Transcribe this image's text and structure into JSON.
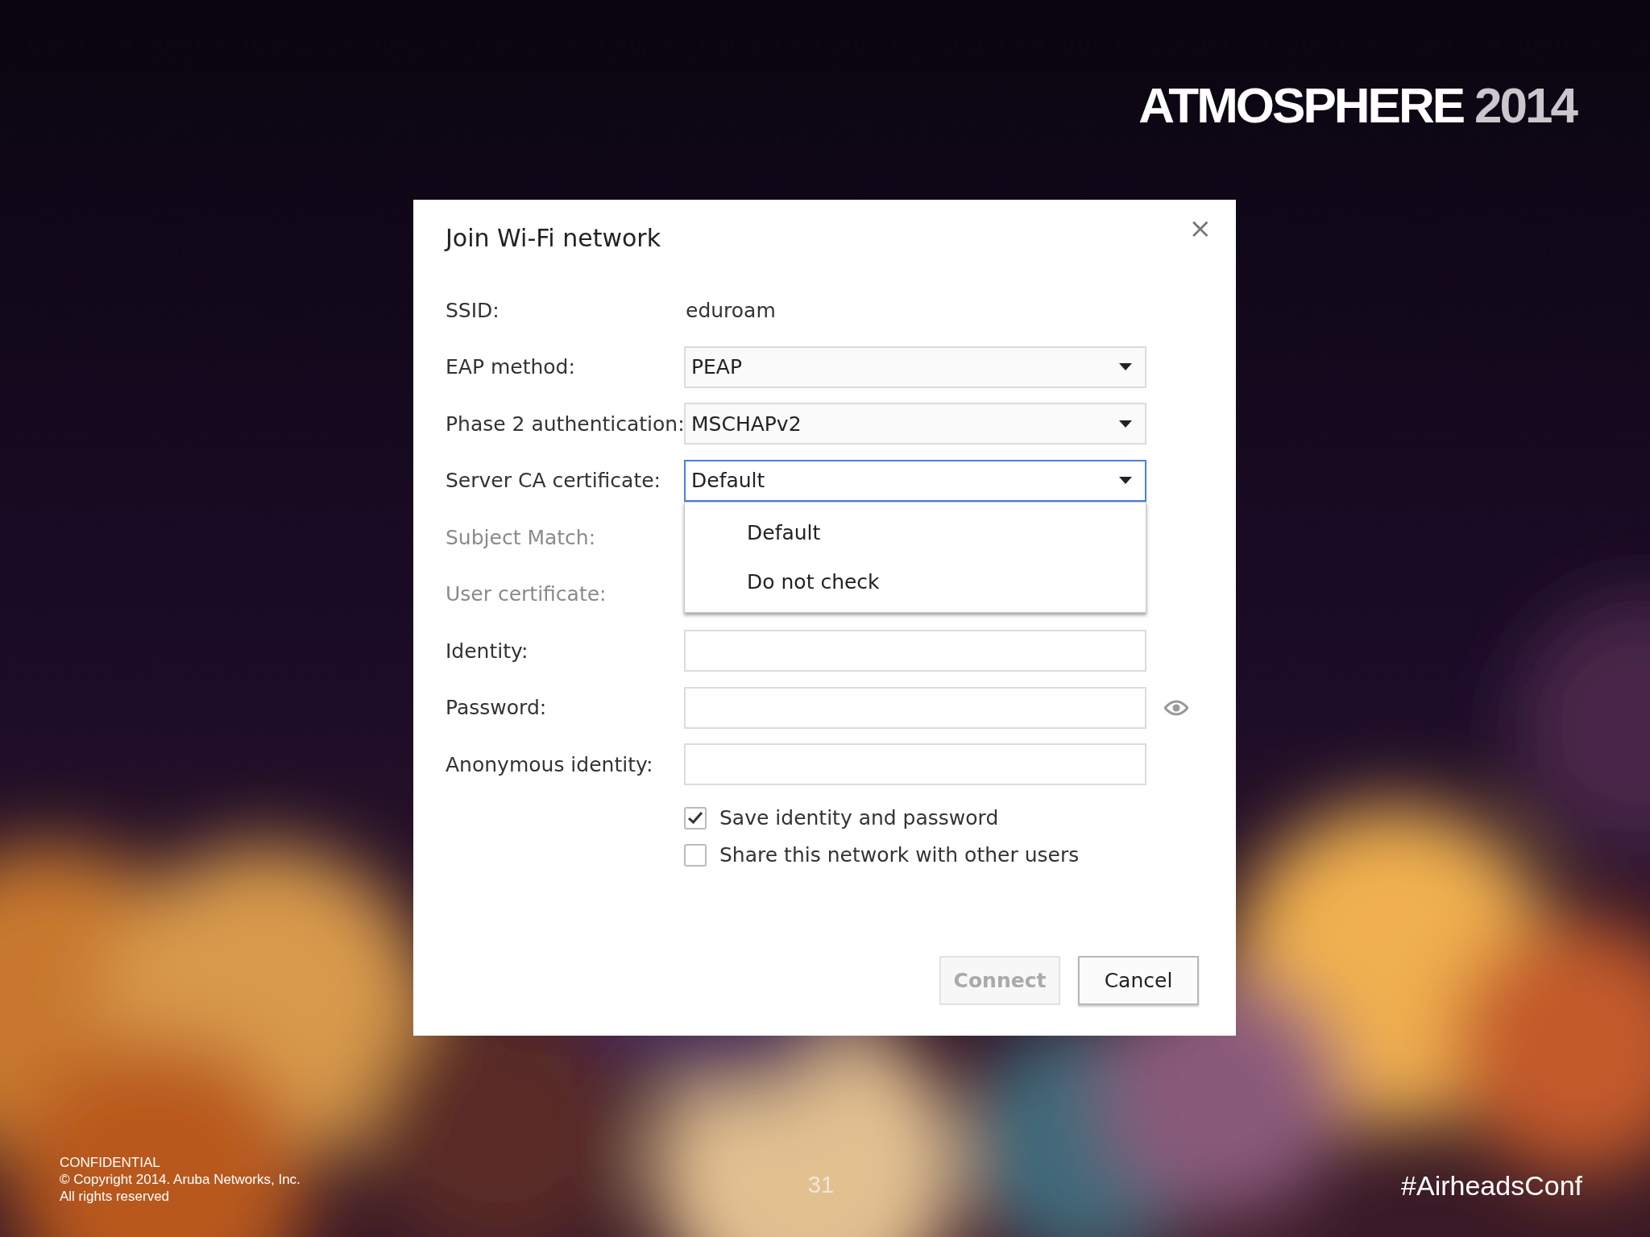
{
  "header": {
    "brand": "ATMOSPHERE",
    "year": "2014"
  },
  "dialog": {
    "title": "Join Wi-Fi network",
    "close": "×",
    "rows": [
      {
        "kind": "text",
        "label": "SSID:",
        "value": "eduroam",
        "disabled": false
      },
      {
        "kind": "select",
        "label": "EAP method:",
        "value": "PEAP",
        "disabled": false
      },
      {
        "kind": "select",
        "label": "Phase 2 authentication:",
        "value": "MSCHAPv2",
        "disabled": false
      },
      {
        "kind": "select",
        "label": "Server CA certificate:",
        "value": "Default",
        "disabled": false,
        "focused": true,
        "expanded": true,
        "options": [
          "Default",
          "Do not check"
        ]
      },
      {
        "kind": "blank",
        "label": "Subject Match:",
        "disabled": true
      },
      {
        "kind": "blank",
        "label": "User certificate:",
        "disabled": true
      },
      {
        "kind": "input",
        "label": "Identity:",
        "disabled": false
      },
      {
        "kind": "password",
        "label": "Password:",
        "disabled": false
      },
      {
        "kind": "input",
        "label": "Anonymous identity:",
        "disabled": false
      }
    ],
    "checkboxes": [
      {
        "label": "Save identity and password",
        "checked": true
      },
      {
        "label": "Share this network with other users",
        "checked": false
      }
    ],
    "buttons": [
      {
        "label": "Connect",
        "disabled": true
      },
      {
        "label": "Cancel",
        "disabled": false
      }
    ]
  },
  "footer": {
    "notice": [
      "CONFIDENTIAL",
      "© Copyright 2014. Aruba Networks, Inc.",
      "All rights reserved"
    ],
    "page": "31",
    "hashtag": "#AirheadsConf"
  }
}
